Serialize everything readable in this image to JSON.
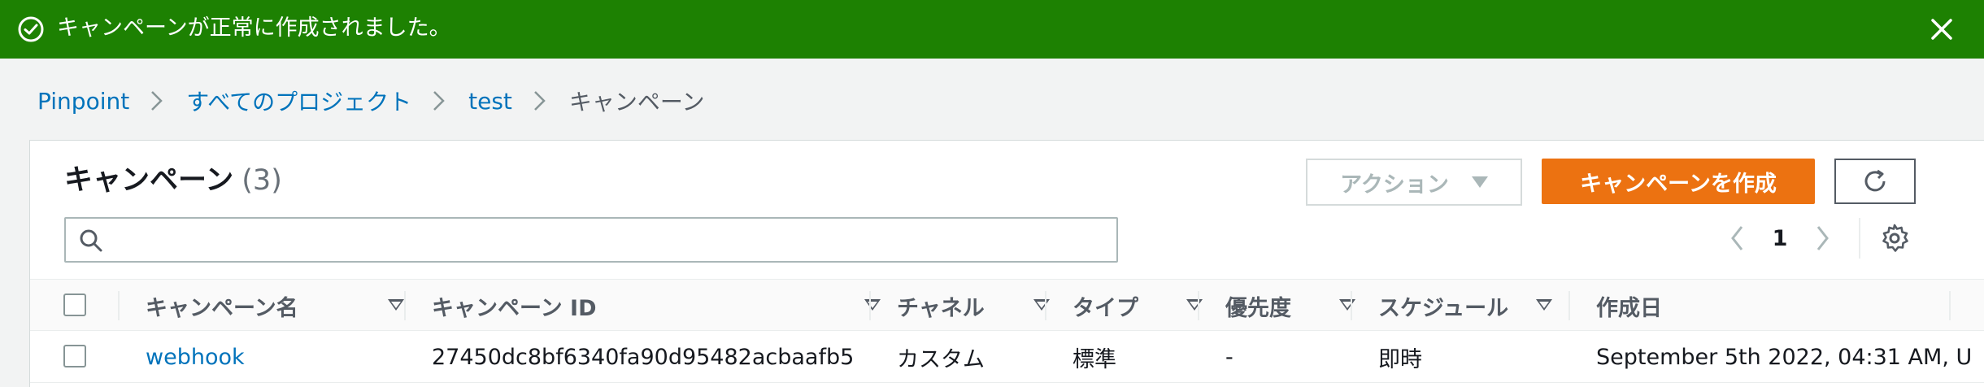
{
  "flash": {
    "message": "キャンペーンが正常に作成されました。",
    "color": "#1d8102",
    "icons": {
      "status": "check-circle-icon",
      "dismiss": "close-icon"
    }
  },
  "breadcrumb": {
    "items": [
      {
        "label": "Pinpoint"
      },
      {
        "label": "すべてのプロジェクト"
      },
      {
        "label": "test"
      },
      {
        "label": "キャンペーン"
      }
    ]
  },
  "panel": {
    "title": "キャンペーン",
    "count": "(3)",
    "actions_label": "アクション",
    "create_label": "キャンペーンを作成",
    "create_color": "#ec7211",
    "search_placeholder": "",
    "search_value": "",
    "pagination": {
      "current_page": "1"
    }
  },
  "table": {
    "columns": [
      {
        "label": "キャンペーン名"
      },
      {
        "label": "キャンペーン ID"
      },
      {
        "label": "チャネル"
      },
      {
        "label": "タイプ"
      },
      {
        "label": "優先度"
      },
      {
        "label": "スケジュール"
      },
      {
        "label": "作成日"
      }
    ],
    "rows": [
      {
        "name": "webhook",
        "id": "27450dc8bf6340fa90d95482acbaafb5",
        "channel": "カスタム",
        "type": "標準",
        "priority": "-",
        "schedule": "即時",
        "created": "September 5th 2022, 04:31 AM, U"
      }
    ]
  },
  "link_color": "#0073bb"
}
